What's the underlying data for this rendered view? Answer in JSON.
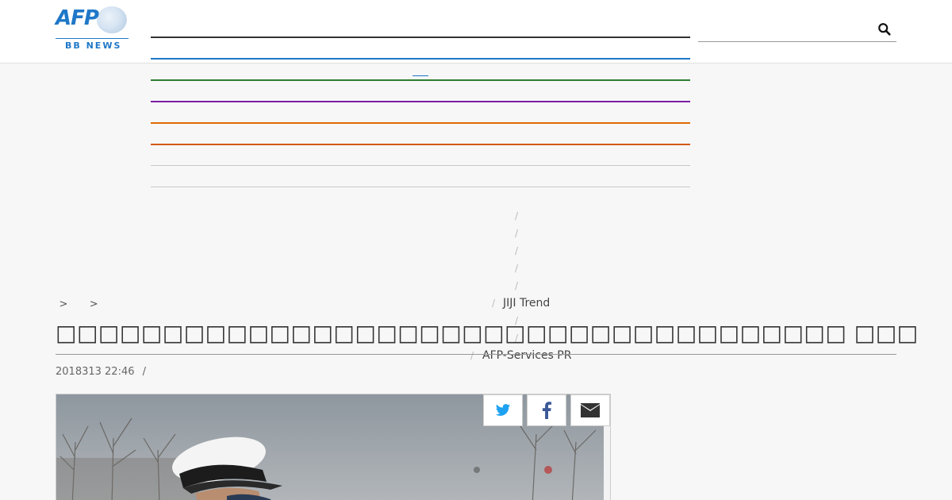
{
  "header": {
    "logo": {
      "brand": "AFP",
      "subtitle": "BB NEWS"
    },
    "nav_line_colors": [
      "#333333",
      "#1f78c8",
      "#2e7d32",
      "#7b1fa2",
      "#e06a00",
      "#d25a10",
      "#c8c8c8",
      "#c8c8c8"
    ],
    "search": {
      "value": "",
      "placeholder": ""
    }
  },
  "dropdown": {
    "items": [
      "JIJI Trend",
      "AFP-Services PR"
    ],
    "separator": "/"
  },
  "breadcrumb": {
    "separator": ">"
  },
  "article": {
    "title": "□□□□□□□□□□□□□□□□□□□□□□□□□□□□□□□□□□□□□ □□□",
    "date": "2018313 22:46",
    "meta_separator": "/"
  },
  "share": {
    "icons": [
      "twitter-icon",
      "facebook-icon",
      "email-icon"
    ],
    "icon_color": "#1da1f2",
    "facebook_color": "#3b5998",
    "email_color": "#333333"
  }
}
